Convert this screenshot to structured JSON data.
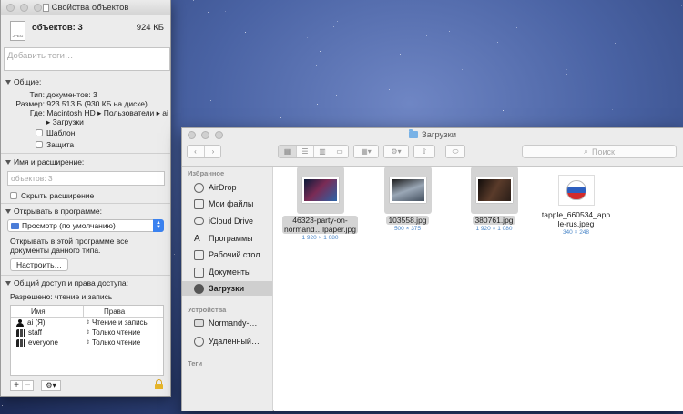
{
  "info_window": {
    "title": "Свойства объектов",
    "header": {
      "count": "объектов: 3",
      "size": "924 КБ",
      "file_icon_label": "JPEG"
    },
    "tags_placeholder": "Добавить теги…",
    "general": {
      "heading": "Общие:",
      "type_label": "Тип:",
      "type_value": "документов: 3",
      "size_label": "Размер:",
      "size_value": "923 513 Б (930 КБ на диске)",
      "where_label": "Где:",
      "where_value": "Macintosh HD ▸ Пользователи ▸ ai",
      "where_value_2": "▸ Загрузки",
      "stationery": "Шаблон",
      "locked": "Защита"
    },
    "name_ext": {
      "heading": "Имя и расширение:",
      "placeholder": "объектов: 3",
      "hide_ext": "Скрыть расширение"
    },
    "open_with": {
      "heading": "Открывать в программе:",
      "app": "Просмотр (по умолчанию)",
      "note_1": "Открывать в этой программе все",
      "note_2": "документы данного типа.",
      "button": "Настроить…"
    },
    "sharing": {
      "heading": "Общий доступ и права доступа:",
      "summary": "Разрешено: чтение и запись",
      "col_name": "Имя",
      "col_priv": "Права",
      "rows": [
        {
          "name": "ai (Я)",
          "priv": "Чтение и запись",
          "icon": "user-icon"
        },
        {
          "name": "staff",
          "priv": "Только чтение",
          "icon": "group-icon"
        },
        {
          "name": "everyone",
          "priv": "Только чтение",
          "icon": "group-icon"
        }
      ]
    },
    "bottom": {
      "add": "+",
      "remove": "−",
      "gear": "⚙▾"
    }
  },
  "finder": {
    "title": "Загрузки",
    "search_placeholder": "Поиск",
    "sidebar": {
      "favorites_heading": "Избранное",
      "favorites": [
        {
          "label": "AirDrop",
          "icon": "airdrop-icon"
        },
        {
          "label": "Мои файлы",
          "icon": "all-files-icon"
        },
        {
          "label": "iCloud Drive",
          "icon": "cloud-icon"
        },
        {
          "label": "Программы",
          "icon": "applications-icon"
        },
        {
          "label": "Рабочий стол",
          "icon": "desktop-icon"
        },
        {
          "label": "Документы",
          "icon": "documents-icon"
        },
        {
          "label": "Загрузки",
          "icon": "downloads-icon",
          "selected": true
        }
      ],
      "devices_heading": "Устройства",
      "devices": [
        {
          "label": "Normandy-…",
          "icon": "computer-icon"
        },
        {
          "label": "Удаленный…",
          "icon": "remote-disc-icon"
        }
      ],
      "tags_heading": "Теги"
    },
    "files": [
      {
        "name_1": "46323-party-on-",
        "name_2": "normand…lpaper.jpg",
        "dims": "1 920 × 1 080",
        "selected": true,
        "colors": [
          "#0b1a3a",
          "#7a2b55",
          "#2b64a8"
        ]
      },
      {
        "name_1": "103558.jpg",
        "name_2": "",
        "dims": "500 × 375",
        "selected": true,
        "colors": [
          "#1a1a1a",
          "#9aa7b6",
          "#44505f"
        ]
      },
      {
        "name_1": "380761.jpg",
        "name_2": "",
        "dims": "1 920 × 1 080",
        "selected": true,
        "colors": [
          "#120d0b",
          "#5a3b2a",
          "#2a1e18"
        ]
      },
      {
        "name_1": "tapple_660534_app",
        "name_2": "le-rus.jpeg",
        "dims": "340 × 248",
        "selected": false,
        "colors": [
          "#ffffff",
          "#2d5fbf",
          "#d22b2b"
        ]
      }
    ]
  }
}
